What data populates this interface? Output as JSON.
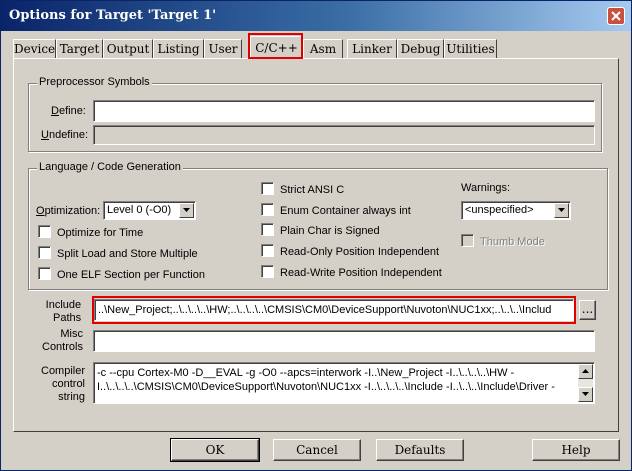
{
  "window": {
    "title": "Options for Target 'Target 1'"
  },
  "tabs": [
    {
      "label": "Device"
    },
    {
      "label": "Target"
    },
    {
      "label": "Output"
    },
    {
      "label": "Listing"
    },
    {
      "label": "User"
    },
    {
      "label": "C/C++",
      "active": true
    },
    {
      "label": "Asm"
    },
    {
      "label": "Linker"
    },
    {
      "label": "Debug"
    },
    {
      "label": "Utilities"
    }
  ],
  "preprocessor": {
    "title": "Preprocessor Symbols",
    "define_label_u": "D",
    "define_label_rest": "efine:",
    "define_value": "",
    "undefine_label_u": "U",
    "undefine_label_rest": "ndefine:",
    "undefine_value": ""
  },
  "language": {
    "title": "Language / Code Generation",
    "optimization_label_u": "O",
    "optimization_label_rest": "ptimization:",
    "optimization_value": "Level 0 (-O0)",
    "optimize_time": "Optimize for Time",
    "split_load": "Split Load and Store Multiple",
    "one_elf": "One ELF Section per Function",
    "strict_ansi": "Strict ANSI C",
    "enum_container": "Enum Container always int",
    "plain_char": "Plain Char is Signed",
    "ropi": "Read-Only Position Independent",
    "rwpi": "Read-Write Position Independent",
    "warnings_label": "Warnings:",
    "warnings_value": "<unspecified>",
    "thumb_mode": "Thumb Mode"
  },
  "include_paths": {
    "label_line1": "Include",
    "label_line2": "Paths",
    "value": "..\\New_Project;..\\..\\..\\..\\HW;..\\..\\..\\..\\CMSIS\\CM0\\DeviceSupport\\Nuvoton\\NUC1xx;..\\..\\..\\Includ",
    "browse_label": "..."
  },
  "misc_controls": {
    "label_line1": "Misc",
    "label_line2": "Controls",
    "value": ""
  },
  "compiler_string": {
    "label_line1": "Compiler",
    "label_line2": "control",
    "label_line3": "string",
    "line1": "-c --cpu Cortex-M0 -D__EVAL -g -O0 --apcs=interwork -I..\\New_Project -I..\\..\\..\\..\\HW -",
    "line2": "I..\\..\\..\\..\\CMSIS\\CM0\\DeviceSupport\\Nuvoton\\NUC1xx -I..\\..\\..\\..\\Include -I..\\..\\..\\Include\\Driver -"
  },
  "buttons": {
    "ok": "OK",
    "cancel": "Cancel",
    "defaults": "Defaults",
    "help": "Help"
  },
  "colors": {
    "highlight": "#e00000",
    "title_bar": "#0a246a"
  }
}
